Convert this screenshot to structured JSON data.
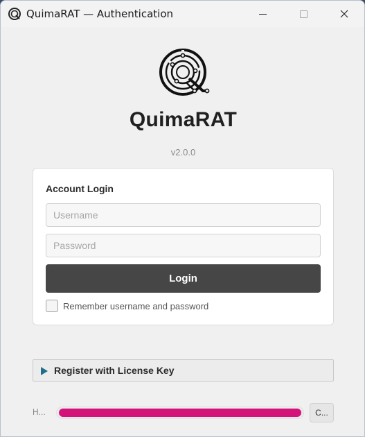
{
  "window": {
    "title": "QuimaRAT — Authentication"
  },
  "app": {
    "name": "QuimaRAT",
    "version": "v2.0.0"
  },
  "login": {
    "heading": "Account Login",
    "username_placeholder": "Username",
    "username_value": "",
    "password_placeholder": "Password",
    "password_value": "",
    "button_label": "Login",
    "remember_label": "Remember username and password",
    "remember_checked": false
  },
  "license": {
    "label": "Register with License Key",
    "icon": "triangle-right-icon"
  },
  "status": {
    "label": "H...",
    "progress": 1.0,
    "cancel_label": "C..."
  },
  "colors": {
    "accent": "#d3137a",
    "login_button": "#464646",
    "license_arrow": "#1f6f8b"
  }
}
